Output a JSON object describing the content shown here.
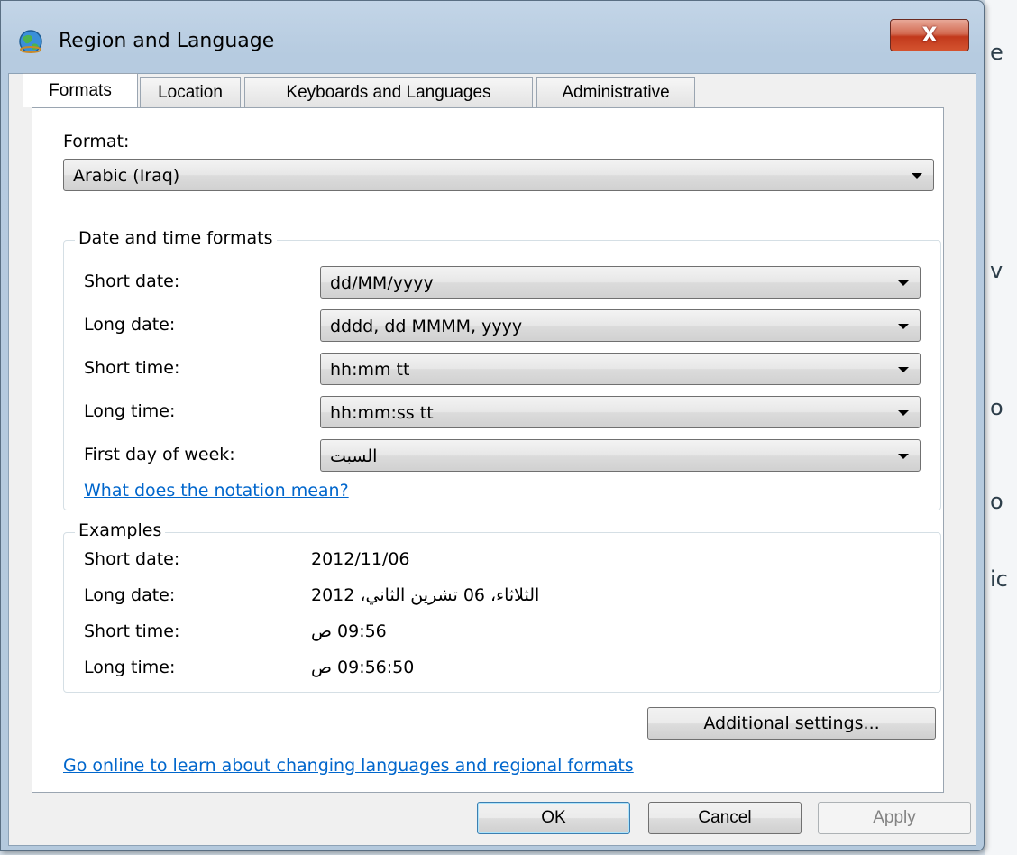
{
  "background": {
    "fragments": [
      "e",
      "v",
      "o",
      "o",
      "ic"
    ]
  },
  "dialog": {
    "title": "Region and Language",
    "close_label": "X"
  },
  "tabs": [
    {
      "label": "Formats",
      "active": true
    },
    {
      "label": "Location",
      "active": false
    },
    {
      "label": "Keyboards and Languages",
      "active": false
    },
    {
      "label": "Administrative",
      "active": false
    }
  ],
  "format": {
    "label": "Format:",
    "value": "Arabic (Iraq)"
  },
  "date_time_formats": {
    "title": "Date and time formats",
    "rows": [
      {
        "label": "Short date:",
        "value": "dd/MM/yyyy"
      },
      {
        "label": "Long date:",
        "value": "dddd, dd MMMM, yyyy"
      },
      {
        "label": "Short time:",
        "value": "hh:mm tt"
      },
      {
        "label": "Long time:",
        "value": "hh:mm:ss tt"
      },
      {
        "label": "First day of week:",
        "value": "السبت"
      }
    ],
    "notation_link": "What does the notation mean?"
  },
  "examples": {
    "title": "Examples",
    "rows": [
      {
        "label": "Short date:",
        "value": "2012/11/06"
      },
      {
        "label": "Long date:",
        "value": "الثلاثاء، 06 تشرين الثاني، 2012"
      },
      {
        "label": "Short time:",
        "value": "09:56 ص"
      },
      {
        "label": "Long time:",
        "value": "09:56:50 ص"
      }
    ]
  },
  "additional_settings_label": "Additional settings...",
  "online_link": "Go online to learn about changing languages and regional formats",
  "buttons": {
    "ok": "OK",
    "cancel": "Cancel",
    "apply": "Apply"
  }
}
